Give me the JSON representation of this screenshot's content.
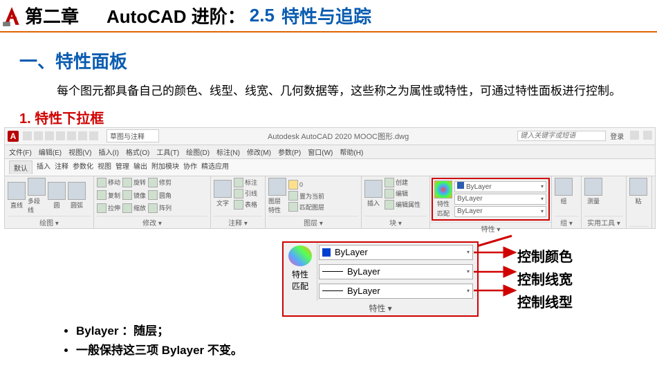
{
  "header": {
    "chapter": "第二章",
    "title_black": "AutoCAD 进阶：",
    "title_num": "2.5",
    "title_sub": "特性与追踪"
  },
  "section_title": "一、特性面板",
  "intro_text": "每个图元都具备自己的颜色、线型、线宽、几何数据等，这些称之为属性或特性，可通过特性面板进行控制。",
  "sub_title": "1. 特性下拉框",
  "ribbon": {
    "layout_select": "草图与注释",
    "titlebar_center": "Autodesk AutoCAD 2020    MOOC图形.dwg",
    "search_placeholder": "键入关键字或短语",
    "login_label": "登录",
    "menus": [
      "文件(F)",
      "编辑(E)",
      "视图(V)",
      "插入(I)",
      "格式(O)",
      "工具(T)",
      "绘图(D)",
      "标注(N)",
      "修改(M)",
      "参数(P)",
      "窗口(W)",
      "帮助(H)"
    ],
    "tabs": [
      "默认",
      "插入",
      "注释",
      "参数化",
      "视图",
      "管理",
      "输出",
      "附加模块",
      "协作",
      "精选应用"
    ],
    "panel_draw": {
      "line": "直线",
      "polyline": "多段线",
      "circle": "圆",
      "arc": "圆弧",
      "label": "绘图 ▾"
    },
    "panel_modify": {
      "move": "移动",
      "rotate": "旋转",
      "trim": "修剪",
      "copy": "复制",
      "mirror": "镜像",
      "fillet": "圆角",
      "stretch": "拉伸",
      "scale": "缩放",
      "array": "阵列",
      "label": "修改 ▾"
    },
    "panel_text": {
      "text": "文字",
      "dim": "标注",
      "lead": "引线",
      "table": "表格",
      "label": "注释 ▾"
    },
    "panel_layer": {
      "layerprop": "图层\n特性",
      "setcurrent": "置为当前",
      "match": "匹配图层",
      "label": "图层 ▾"
    },
    "panel_block": {
      "insert": "插入",
      "create": "创建",
      "edit": "编辑",
      "editattr": "编辑属性",
      "label": "块 ▾"
    },
    "panel_props": {
      "matchprop_line1": "特性",
      "matchprop_line2": "匹配",
      "color": "ByLayer",
      "lweight": "ByLayer",
      "ltype": "ByLayer",
      "label": "特性 ▾"
    },
    "panel_group": {
      "group": "组",
      "label": "组 ▾"
    },
    "panel_util": {
      "measure": "测量",
      "label": "实用工具 ▾"
    },
    "panel_clip": {
      "clip": "粘",
      "label": ""
    }
  },
  "zoom": {
    "matchprop_line1": "特性",
    "matchprop_line2": "匹配",
    "color": "ByLayer",
    "lweight": "ByLayer",
    "ltype": "ByLayer",
    "foot": "特性 ▾"
  },
  "callouts": {
    "color": "控制颜色",
    "lweight": "控制线宽",
    "ltype": "控制线型"
  },
  "bullets": {
    "b1": "Bylayer ：随层；",
    "b2": "一般保持这三项 Bylayer 不变。"
  }
}
